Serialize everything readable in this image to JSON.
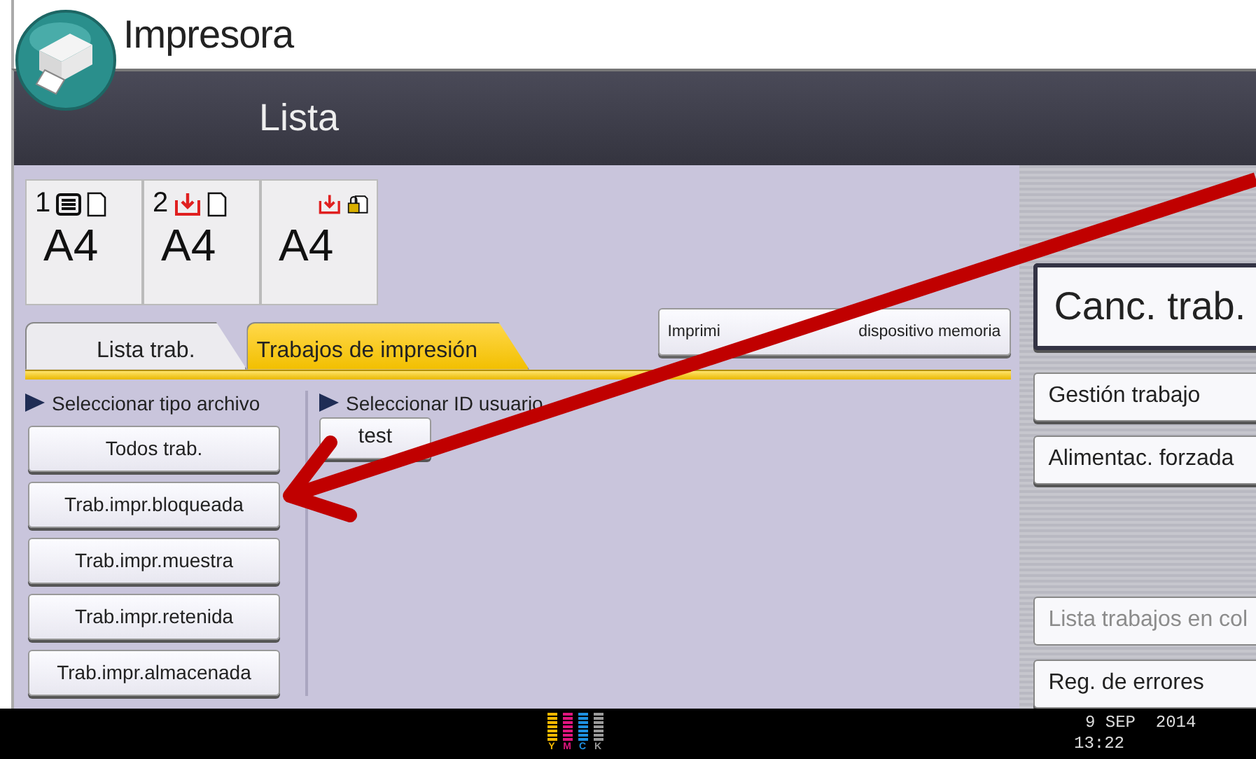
{
  "header": {
    "title": "Impresora",
    "subtitle": "Lista"
  },
  "trays": [
    {
      "number": "1",
      "kind": "tray",
      "locked": false,
      "size": "A4"
    },
    {
      "number": "2",
      "kind": "manual",
      "locked": false,
      "size": "A4"
    },
    {
      "kind": "manual",
      "locked": true,
      "size": "A4"
    }
  ],
  "tabs": [
    {
      "label": "Lista trab.",
      "selected": false
    },
    {
      "label": "Trabajos de impresión",
      "selected": true
    }
  ],
  "memory_button": {
    "parts": [
      "Imprimi",
      "dispositivo memoria"
    ]
  },
  "file_types": {
    "label": "Seleccionar tipo archivo",
    "buttons": [
      "Todos trab.",
      "Trab.impr.bloqueada",
      "Trab.impr.muestra",
      "Trab.impr.retenida",
      "Trab.impr.almacenada"
    ]
  },
  "user_ids": {
    "label": "Seleccionar ID usuario",
    "buttons": [
      "test"
    ]
  },
  "side_buttons": [
    {
      "label": "Canc. trab.",
      "kind": "large",
      "disabled": false
    },
    {
      "label": "Gestión trabajo",
      "kind": "normal",
      "disabled": false
    },
    {
      "label": "Alimentac. forzada",
      "kind": "normal",
      "disabled": false
    },
    {
      "kind": "gap"
    },
    {
      "label": "Lista trabajos en col",
      "kind": "normal",
      "disabled": true
    },
    {
      "label": "Reg. de errores",
      "kind": "normal",
      "disabled": false
    }
  ],
  "status_bar": {
    "toners": [
      {
        "label": "Y",
        "color": "#f5b800"
      },
      {
        "label": "M",
        "color": "#e0157f"
      },
      {
        "label": "C",
        "color": "#1e90e0"
      },
      {
        "label": "K",
        "color": "#9a9a9a"
      }
    ],
    "date": "9 SEP  2014",
    "time": "13:22"
  }
}
